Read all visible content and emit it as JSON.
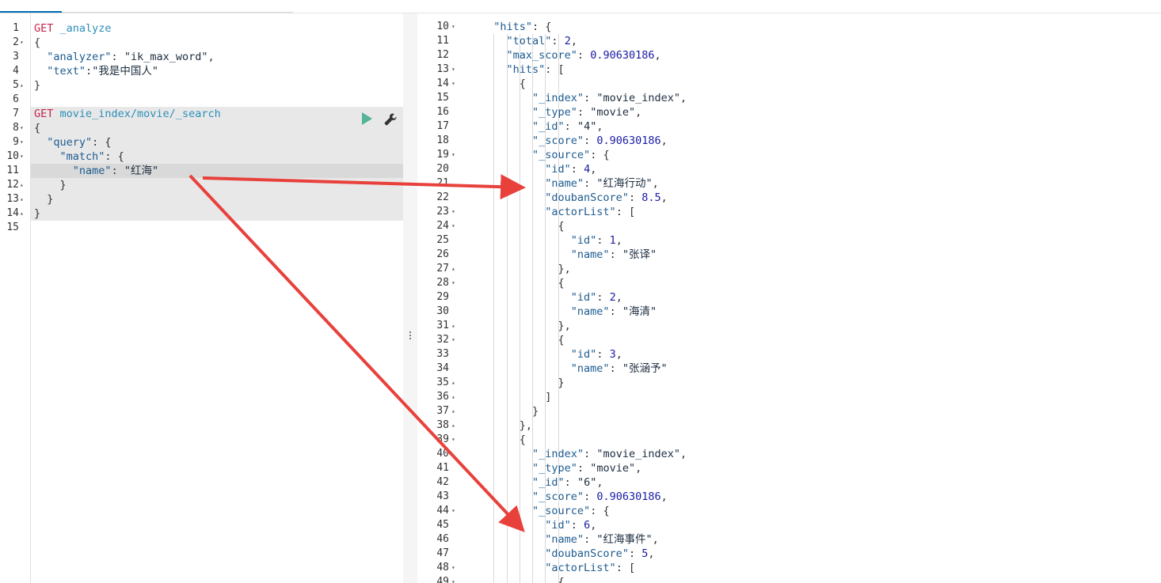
{
  "left_editor": {
    "lines": [
      {
        "n": "1",
        "fold": "",
        "segs": [
          [
            "m",
            "GET "
          ],
          [
            "u",
            "_analyze"
          ]
        ]
      },
      {
        "n": "2",
        "fold": "▾",
        "segs": [
          [
            "p",
            "{"
          ]
        ]
      },
      {
        "n": "3",
        "fold": "",
        "segs": [
          [
            "p",
            "  "
          ],
          [
            "k",
            "\"analyzer\""
          ],
          [
            "p",
            ": "
          ],
          [
            "s",
            "\"ik_max_word\""
          ],
          [
            "p",
            ","
          ]
        ]
      },
      {
        "n": "4",
        "fold": "",
        "segs": [
          [
            "p",
            "  "
          ],
          [
            "k",
            "\"text\""
          ],
          [
            "p",
            ":"
          ],
          [
            "s",
            "\"我是中国人\""
          ]
        ]
      },
      {
        "n": "5",
        "fold": "▴",
        "segs": [
          [
            "p",
            "}"
          ]
        ]
      },
      {
        "n": "6",
        "fold": "",
        "segs": []
      },
      {
        "n": "7",
        "fold": "",
        "segs": [
          [
            "m",
            "GET "
          ],
          [
            "u",
            "movie_index/movie/_search"
          ]
        ]
      },
      {
        "n": "8",
        "fold": "▾",
        "segs": [
          [
            "p",
            "{"
          ]
        ]
      },
      {
        "n": "9",
        "fold": "▾",
        "segs": [
          [
            "p",
            "  "
          ],
          [
            "k",
            "\"query\""
          ],
          [
            "p",
            ": {"
          ]
        ]
      },
      {
        "n": "10",
        "fold": "▾",
        "segs": [
          [
            "p",
            "    "
          ],
          [
            "k",
            "\"match\""
          ],
          [
            "p",
            ": {"
          ]
        ]
      },
      {
        "n": "11",
        "fold": "",
        "segs": [
          [
            "p",
            "      "
          ],
          [
            "k",
            "\"name\""
          ],
          [
            "p",
            ": "
          ],
          [
            "s",
            "\"红海\""
          ]
        ]
      },
      {
        "n": "12",
        "fold": "▴",
        "segs": [
          [
            "p",
            "    }"
          ]
        ]
      },
      {
        "n": "13",
        "fold": "▴",
        "segs": [
          [
            "p",
            "  }"
          ]
        ]
      },
      {
        "n": "14",
        "fold": "▴",
        "segs": [
          [
            "p",
            "}"
          ]
        ]
      },
      {
        "n": "15",
        "fold": "",
        "segs": []
      }
    ]
  },
  "right_editor": {
    "lines": [
      {
        "n": "10",
        "fold": "▾",
        "segs": [
          [
            "p",
            "  "
          ],
          [
            "k",
            "\"hits\""
          ],
          [
            "p",
            ": {"
          ]
        ]
      },
      {
        "n": "11",
        "fold": "",
        "segs": [
          [
            "p",
            "    "
          ],
          [
            "k",
            "\"total\""
          ],
          [
            "p",
            ": "
          ],
          [
            "n",
            "2"
          ],
          [
            "p",
            ","
          ]
        ]
      },
      {
        "n": "12",
        "fold": "",
        "segs": [
          [
            "p",
            "    "
          ],
          [
            "k",
            "\"max_score\""
          ],
          [
            "p",
            ": "
          ],
          [
            "n",
            "0.90630186"
          ],
          [
            "p",
            ","
          ]
        ]
      },
      {
        "n": "13",
        "fold": "▾",
        "segs": [
          [
            "p",
            "    "
          ],
          [
            "k",
            "\"hits\""
          ],
          [
            "p",
            ": ["
          ]
        ]
      },
      {
        "n": "14",
        "fold": "▾",
        "segs": [
          [
            "p",
            "      {"
          ]
        ]
      },
      {
        "n": "15",
        "fold": "",
        "segs": [
          [
            "p",
            "        "
          ],
          [
            "k",
            "\"_index\""
          ],
          [
            "p",
            ": "
          ],
          [
            "s",
            "\"movie_index\""
          ],
          [
            "p",
            ","
          ]
        ]
      },
      {
        "n": "16",
        "fold": "",
        "segs": [
          [
            "p",
            "        "
          ],
          [
            "k",
            "\"_type\""
          ],
          [
            "p",
            ": "
          ],
          [
            "s",
            "\"movie\""
          ],
          [
            "p",
            ","
          ]
        ]
      },
      {
        "n": "17",
        "fold": "",
        "segs": [
          [
            "p",
            "        "
          ],
          [
            "k",
            "\"_id\""
          ],
          [
            "p",
            ": "
          ],
          [
            "s",
            "\"4\""
          ],
          [
            "p",
            ","
          ]
        ]
      },
      {
        "n": "18",
        "fold": "",
        "segs": [
          [
            "p",
            "        "
          ],
          [
            "k",
            "\"_score\""
          ],
          [
            "p",
            ": "
          ],
          [
            "n",
            "0.90630186"
          ],
          [
            "p",
            ","
          ]
        ]
      },
      {
        "n": "19",
        "fold": "▾",
        "segs": [
          [
            "p",
            "        "
          ],
          [
            "k",
            "\"_source\""
          ],
          [
            "p",
            ": {"
          ]
        ]
      },
      {
        "n": "20",
        "fold": "",
        "segs": [
          [
            "p",
            "          "
          ],
          [
            "k",
            "\"id\""
          ],
          [
            "p",
            ": "
          ],
          [
            "n",
            "4"
          ],
          [
            "p",
            ","
          ]
        ]
      },
      {
        "n": "21",
        "fold": "",
        "segs": [
          [
            "p",
            "          "
          ],
          [
            "k",
            "\"name\""
          ],
          [
            "p",
            ": "
          ],
          [
            "s",
            "\"红海行动\""
          ],
          [
            "p",
            ","
          ]
        ]
      },
      {
        "n": "22",
        "fold": "",
        "segs": [
          [
            "p",
            "          "
          ],
          [
            "k",
            "\"doubanScore\""
          ],
          [
            "p",
            ": "
          ],
          [
            "n",
            "8.5"
          ],
          [
            "p",
            ","
          ]
        ]
      },
      {
        "n": "23",
        "fold": "▾",
        "segs": [
          [
            "p",
            "          "
          ],
          [
            "k",
            "\"actorList\""
          ],
          [
            "p",
            ": ["
          ]
        ]
      },
      {
        "n": "24",
        "fold": "▾",
        "segs": [
          [
            "p",
            "            {"
          ]
        ]
      },
      {
        "n": "25",
        "fold": "",
        "segs": [
          [
            "p",
            "              "
          ],
          [
            "k",
            "\"id\""
          ],
          [
            "p",
            ": "
          ],
          [
            "n",
            "1"
          ],
          [
            "p",
            ","
          ]
        ]
      },
      {
        "n": "26",
        "fold": "",
        "segs": [
          [
            "p",
            "              "
          ],
          [
            "k",
            "\"name\""
          ],
          [
            "p",
            ": "
          ],
          [
            "s",
            "\"张译\""
          ]
        ]
      },
      {
        "n": "27",
        "fold": "▴",
        "segs": [
          [
            "p",
            "            },"
          ]
        ]
      },
      {
        "n": "28",
        "fold": "▾",
        "segs": [
          [
            "p",
            "            {"
          ]
        ]
      },
      {
        "n": "29",
        "fold": "",
        "segs": [
          [
            "p",
            "              "
          ],
          [
            "k",
            "\"id\""
          ],
          [
            "p",
            ": "
          ],
          [
            "n",
            "2"
          ],
          [
            "p",
            ","
          ]
        ]
      },
      {
        "n": "30",
        "fold": "",
        "segs": [
          [
            "p",
            "              "
          ],
          [
            "k",
            "\"name\""
          ],
          [
            "p",
            ": "
          ],
          [
            "s",
            "\"海清\""
          ]
        ]
      },
      {
        "n": "31",
        "fold": "▴",
        "segs": [
          [
            "p",
            "            },"
          ]
        ]
      },
      {
        "n": "32",
        "fold": "▾",
        "segs": [
          [
            "p",
            "            {"
          ]
        ]
      },
      {
        "n": "33",
        "fold": "",
        "segs": [
          [
            "p",
            "              "
          ],
          [
            "k",
            "\"id\""
          ],
          [
            "p",
            ": "
          ],
          [
            "n",
            "3"
          ],
          [
            "p",
            ","
          ]
        ]
      },
      {
        "n": "34",
        "fold": "",
        "segs": [
          [
            "p",
            "              "
          ],
          [
            "k",
            "\"name\""
          ],
          [
            "p",
            ": "
          ],
          [
            "s",
            "\"张涵予\""
          ]
        ]
      },
      {
        "n": "35",
        "fold": "▴",
        "segs": [
          [
            "p",
            "            }"
          ]
        ]
      },
      {
        "n": "36",
        "fold": "▴",
        "segs": [
          [
            "p",
            "          ]"
          ]
        ]
      },
      {
        "n": "37",
        "fold": "▴",
        "segs": [
          [
            "p",
            "        }"
          ]
        ]
      },
      {
        "n": "38",
        "fold": "▴",
        "segs": [
          [
            "p",
            "      },"
          ]
        ]
      },
      {
        "n": "39",
        "fold": "▾",
        "segs": [
          [
            "p",
            "      {"
          ]
        ]
      },
      {
        "n": "40",
        "fold": "",
        "segs": [
          [
            "p",
            "        "
          ],
          [
            "k",
            "\"_index\""
          ],
          [
            "p",
            ": "
          ],
          [
            "s",
            "\"movie_index\""
          ],
          [
            "p",
            ","
          ]
        ]
      },
      {
        "n": "41",
        "fold": "",
        "segs": [
          [
            "p",
            "        "
          ],
          [
            "k",
            "\"_type\""
          ],
          [
            "p",
            ": "
          ],
          [
            "s",
            "\"movie\""
          ],
          [
            "p",
            ","
          ]
        ]
      },
      {
        "n": "42",
        "fold": "",
        "segs": [
          [
            "p",
            "        "
          ],
          [
            "k",
            "\"_id\""
          ],
          [
            "p",
            ": "
          ],
          [
            "s",
            "\"6\""
          ],
          [
            "p",
            ","
          ]
        ]
      },
      {
        "n": "43",
        "fold": "",
        "segs": [
          [
            "p",
            "        "
          ],
          [
            "k",
            "\"_score\""
          ],
          [
            "p",
            ": "
          ],
          [
            "n",
            "0.90630186"
          ],
          [
            "p",
            ","
          ]
        ]
      },
      {
        "n": "44",
        "fold": "▾",
        "segs": [
          [
            "p",
            "        "
          ],
          [
            "k",
            "\"_source\""
          ],
          [
            "p",
            ": {"
          ]
        ]
      },
      {
        "n": "45",
        "fold": "",
        "segs": [
          [
            "p",
            "          "
          ],
          [
            "k",
            "\"id\""
          ],
          [
            "p",
            ": "
          ],
          [
            "n",
            "6"
          ],
          [
            "p",
            ","
          ]
        ]
      },
      {
        "n": "46",
        "fold": "",
        "segs": [
          [
            "p",
            "          "
          ],
          [
            "k",
            "\"name\""
          ],
          [
            "p",
            ": "
          ],
          [
            "s",
            "\"红海事件\""
          ],
          [
            "p",
            ","
          ]
        ]
      },
      {
        "n": "47",
        "fold": "",
        "segs": [
          [
            "p",
            "          "
          ],
          [
            "k",
            "\"doubanScore\""
          ],
          [
            "p",
            ": "
          ],
          [
            "n",
            "5"
          ],
          [
            "p",
            ","
          ]
        ]
      },
      {
        "n": "48",
        "fold": "▾",
        "segs": [
          [
            "p",
            "          "
          ],
          [
            "k",
            "\"actorList\""
          ],
          [
            "p",
            ": ["
          ]
        ]
      },
      {
        "n": "49",
        "fold": "▾",
        "segs": [
          [
            "p",
            "            {"
          ]
        ]
      }
    ]
  },
  "colors": {
    "method": "#c7254e",
    "url": "#2b8fb8",
    "key": "#1d5b8f",
    "string": "#1c2d3f",
    "number": "#1a1aa6",
    "run": "#54b399",
    "arrow": "#e8413c"
  },
  "icons": {
    "run": "play-icon",
    "settings": "wrench-icon",
    "splitter": "vertical-dots-icon"
  }
}
